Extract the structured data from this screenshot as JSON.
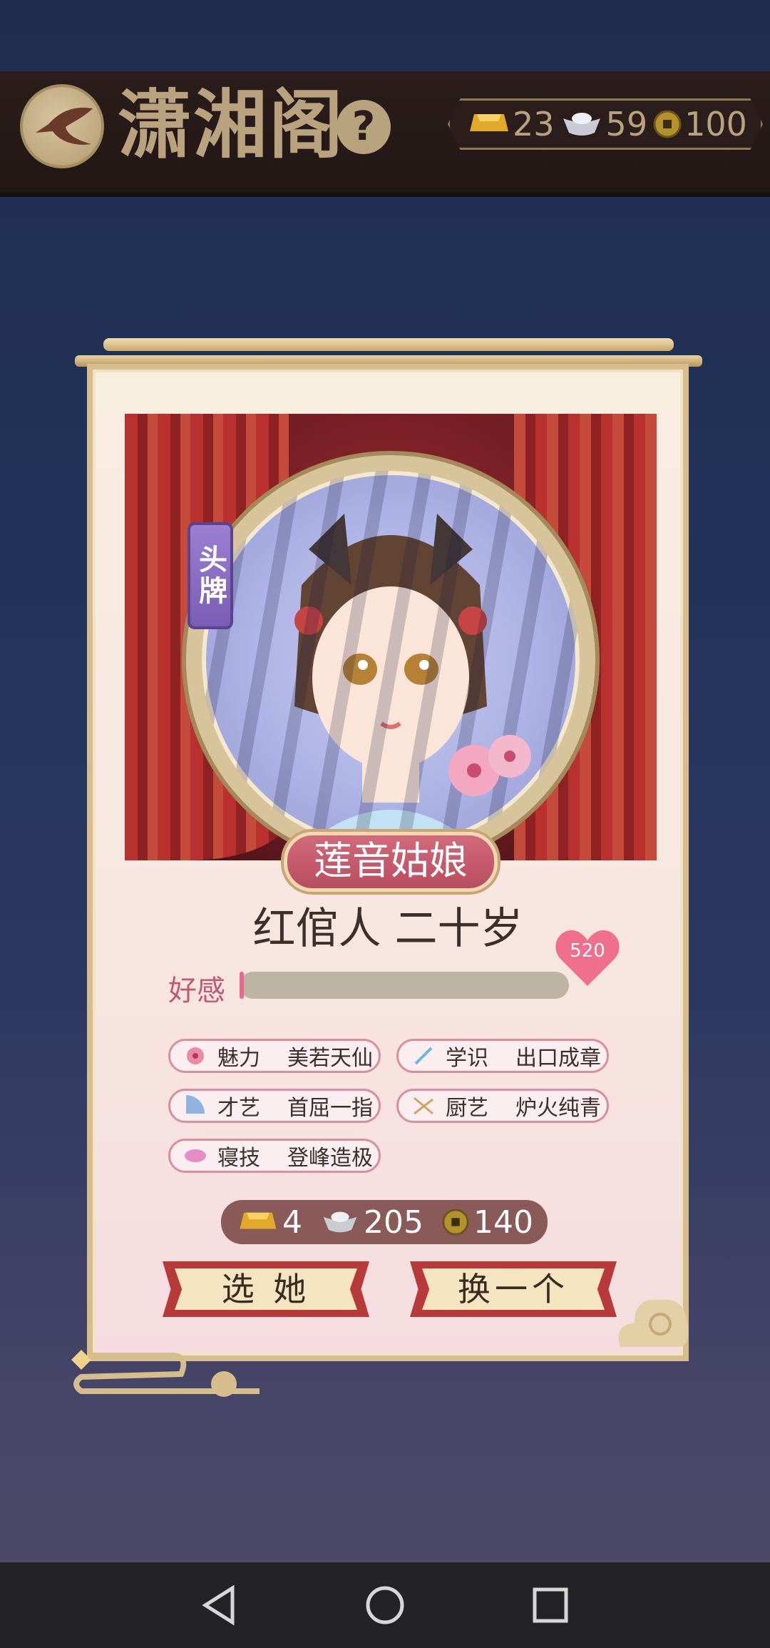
{
  "header": {
    "title": "潇湘阁",
    "help": "?",
    "currency": {
      "gold": "23",
      "silver": "59",
      "coin": "100"
    }
  },
  "card": {
    "badge": "头牌",
    "name": "莲音姑娘",
    "rank": "红倌人 二十岁",
    "affection_label": "好感",
    "affection_value": "520",
    "affection_fraction": 0.01,
    "traits": [
      {
        "icon": "flower-icon",
        "name": "魅力",
        "value": "美若天仙"
      },
      {
        "icon": "brush-icon",
        "name": "学识",
        "value": "出口成章"
      },
      {
        "icon": "fan-icon",
        "name": "才艺",
        "value": "首屈一指"
      },
      {
        "icon": "chopsticks-icon",
        "name": "厨艺",
        "value": "炉火纯青"
      },
      {
        "icon": "pillow-icon",
        "name": "寝技",
        "value": "登峰造极"
      }
    ],
    "price": {
      "gold": "4",
      "silver": "205",
      "coin": "140"
    },
    "select_button": "选 她",
    "change_button": "换一个"
  },
  "colors": {
    "accent": "#b73a3a",
    "header_text": "#b9a37f",
    "affection_pink": "#c05a76",
    "background": "#22335a"
  },
  "navbar": {
    "back": "back-triangle-icon",
    "home": "home-circle-icon",
    "recents": "recents-square-icon"
  }
}
